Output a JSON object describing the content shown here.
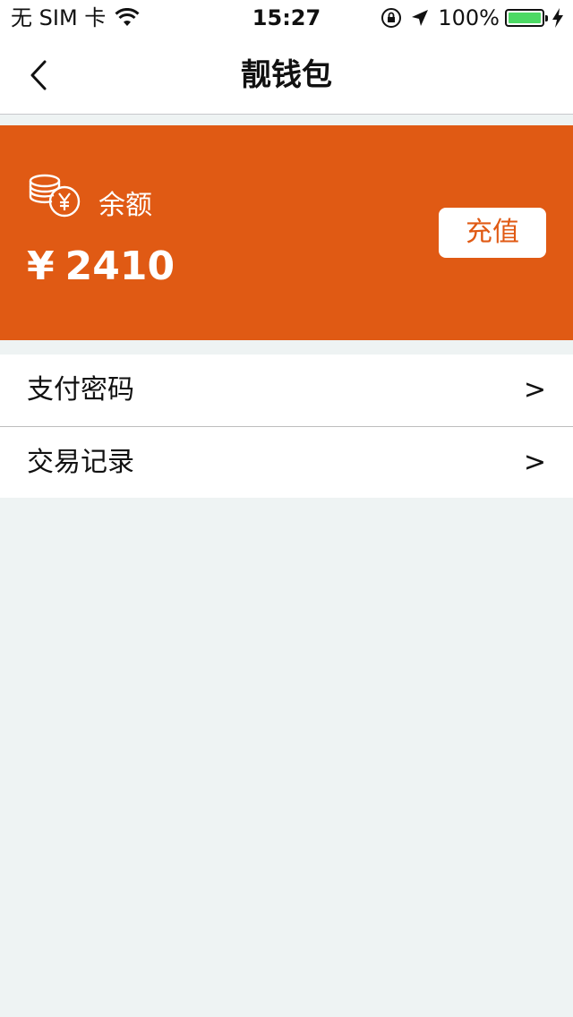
{
  "status_bar": {
    "carrier": "无 SIM 卡",
    "time": "15:27",
    "battery_text": "100%",
    "battery_level": 1.0,
    "battery_color": "#4cd964"
  },
  "nav": {
    "title": "靓钱包",
    "back_icon": "chevron-left-icon"
  },
  "balance_card": {
    "background": "#e05a14",
    "icon": "coins-yen-icon",
    "label": "余额",
    "currency": "¥",
    "amount": "2410",
    "recharge_label": "充值"
  },
  "menu": {
    "items": [
      {
        "label": "支付密码",
        "chevron": ">"
      },
      {
        "label": "交易记录",
        "chevron": ">"
      }
    ]
  }
}
